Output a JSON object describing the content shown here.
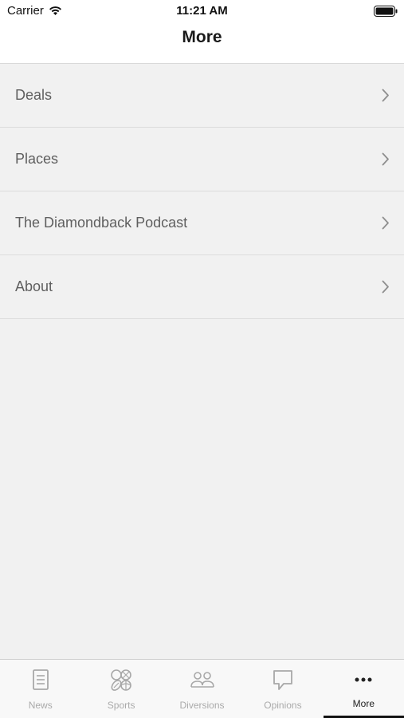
{
  "status_bar": {
    "carrier": "Carrier",
    "time": "11:21 AM"
  },
  "header": {
    "title": "More"
  },
  "menu": {
    "items": [
      {
        "label": "Deals"
      },
      {
        "label": "Places"
      },
      {
        "label": "The Diamondback Podcast"
      },
      {
        "label": "About"
      }
    ]
  },
  "tab_bar": {
    "tabs": [
      {
        "label": "News",
        "icon": "document-icon"
      },
      {
        "label": "Sports",
        "icon": "sports-balls-icon"
      },
      {
        "label": "Diversions",
        "icon": "people-icon"
      },
      {
        "label": "Opinions",
        "icon": "speech-bubble-icon"
      },
      {
        "label": "More",
        "icon": "more-dots-icon"
      }
    ],
    "active_tab": "More"
  },
  "colors": {
    "inactive_tab": "#aaaaaa",
    "active_tab": "#222222",
    "background": "#f1f1f1"
  }
}
